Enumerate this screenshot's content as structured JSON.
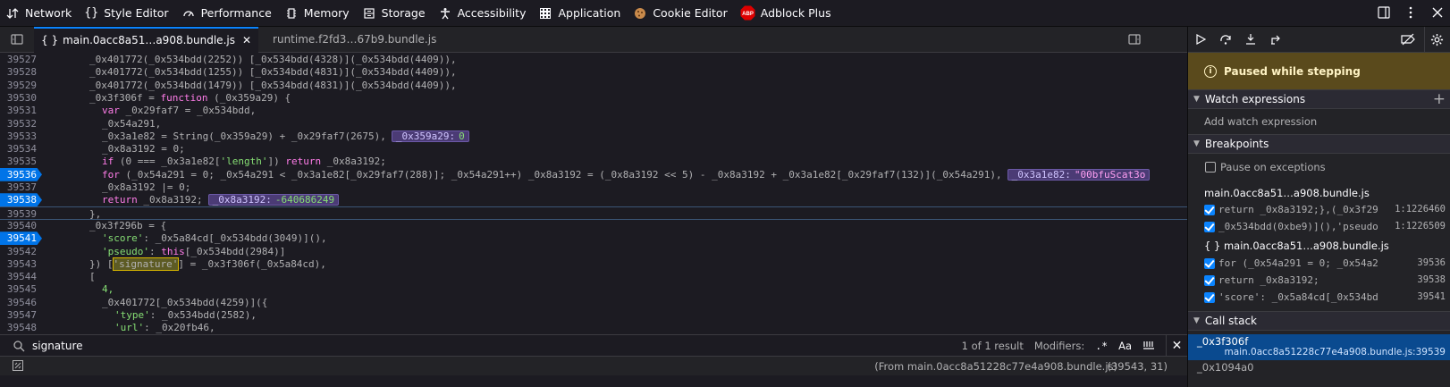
{
  "toolbar": {
    "tabs": [
      {
        "label": "Network",
        "icon": "network-arrows-icon"
      },
      {
        "label": "Style Editor",
        "icon": "braces-icon"
      },
      {
        "label": "Performance",
        "icon": "speedometer-icon"
      },
      {
        "label": "Memory",
        "icon": "memory-chip-icon"
      },
      {
        "label": "Storage",
        "icon": "storage-drawer-icon"
      },
      {
        "label": "Accessibility",
        "icon": "accessibility-person-icon"
      },
      {
        "label": "Application",
        "icon": "grid-dots-icon"
      },
      {
        "label": "Cookie Editor",
        "icon": "cookie-icon"
      },
      {
        "label": "Adblock Plus",
        "icon": "abp-logo-icon"
      }
    ],
    "abp_logo_text": "ABP"
  },
  "editor": {
    "tabs": [
      {
        "label": "main.0acc8a51…a908.bundle.js",
        "active": true
      },
      {
        "label": "runtime.f2fd3…67b9.bundle.js",
        "active": false
      }
    ],
    "tab_braces": "{ }",
    "close_glyph": "✕",
    "lines": [
      {
        "n": "39527",
        "bp": false
      },
      {
        "n": "39528",
        "bp": false
      },
      {
        "n": "39529",
        "bp": false
      },
      {
        "n": "39530",
        "bp": false
      },
      {
        "n": "39531",
        "bp": false
      },
      {
        "n": "39532",
        "bp": false
      },
      {
        "n": "39533",
        "bp": false
      },
      {
        "n": "39534",
        "bp": false
      },
      {
        "n": "39535",
        "bp": false
      },
      {
        "n": "39536",
        "bp": true
      },
      {
        "n": "39537",
        "bp": false
      },
      {
        "n": "39538",
        "bp": true
      },
      {
        "n": "39539",
        "bp": false
      },
      {
        "n": "39540",
        "bp": false
      },
      {
        "n": "39541",
        "bp": true
      },
      {
        "n": "39542",
        "bp": false
      },
      {
        "n": "39543",
        "bp": false
      },
      {
        "n": "39544",
        "bp": false
      },
      {
        "n": "39545",
        "bp": false
      },
      {
        "n": "39546",
        "bp": false
      },
      {
        "n": "39547",
        "bp": false
      },
      {
        "n": "39548",
        "bp": false
      }
    ],
    "code": {
      "l1": "_0x401772(_0x534bdd(2252)) [_0x534bdd(4328)](_0x534bdd(4409)),",
      "l2": "_0x401772(_0x534bdd(1255)) [_0x534bdd(4831)](_0x534bdd(4409)),",
      "l3": "_0x401772(_0x534bdd(1479)) [_0x534bdd(4831)](_0x534bdd(4409)),",
      "l4a": "_0x3f306f = ",
      "l4b": "function",
      "l4c": " (_0x359a29) {",
      "l5a": "var",
      "l5b": " _0x29faf7 = _0x534bdd,",
      "l6": "_0x54a291,",
      "l7a": "_0x3a1e82 = String(_0x359a29) + _0x29faf7(2675),",
      "l7_dbg_name": "_0x359a29:",
      "l7_dbg_val": "0",
      "l8": "_0x8a3192 = 0;",
      "l9a": "if",
      "l9b": " (0 === _0x3a1e82[",
      "l9c": "'length'",
      "l9d": "]) ",
      "l9e": "return",
      "l9f": " _0x8a3192;",
      "l10a": "for",
      "l10b": " (_0x54a291 = 0; _0x54a291 < _0x3a1e82[_0x29faf7(288)]; _0x54a291++) _0x8a3192 = (_0x8a3192 << 5) - _0x8a3192 + _0x3a1e82[_0x29faf7(132)](_0x54a291),",
      "l10_dbg_name": "_0x3a1e82:",
      "l10_dbg_val": "\"00bfuScat3o",
      "l11": "_0x8a3192 |= 0;",
      "l12a": "return",
      "l12b": " _0x8a3192;",
      "l12_dbg_name": "_0x8a3192:",
      "l12_dbg_val": "-640686249",
      "l13": "},",
      "l14": "_0x3f296b = {",
      "l15a": "'score'",
      "l15b": ": _0x5a84cd[_0x534bdd(3049)](),",
      "l16a": "'pseudo'",
      "l16b": ": ",
      "l16c": "this",
      "l16d": "[_0x534bdd(2984)]",
      "l17a": "}) [",
      "l17b": "'signature'",
      "l17c": "] = _0x3f306f(_0x5a84cd),",
      "l18": "[",
      "l19": "4,",
      "l20": "_0x401772[_0x534bdd(4259)]({",
      "l21a": "'type'",
      "l21b": ": _0x534bdd(2582),",
      "l22a": "'url'",
      "l22b": ": _0x20fb46,"
    }
  },
  "search": {
    "query": "signature",
    "result_count": "1 of 1 result",
    "modifiers_label": "Modifiers:",
    "regex_glyph": ".*",
    "case_glyph": "Aa",
    "close_glyph": "✕"
  },
  "status": {
    "source": "(From main.0acc8a51228c77e4a908.bundle.js)",
    "position": "(39543, 31)"
  },
  "debugger": {
    "paused_message": "Paused while stepping",
    "watch_title": "Watch expressions",
    "add_watch": "Add watch expression",
    "add_glyph": "+",
    "breakpoints_title": "Breakpoints",
    "pause_on_exceptions": "Pause on exceptions",
    "bp_group1": "main.0acc8a51…a908.bundle.js",
    "bp_group1_items": [
      {
        "code": "return _0x8a3192;},(_0x3f29…",
        "line": "1:1226460"
      },
      {
        "code": "_0x534bdd(0xbe9)](),'pseudo…",
        "line": "1:1226509"
      }
    ],
    "bp_group2": "{ } main.0acc8a51…a908.bundle.js",
    "bp_group2_items": [
      {
        "code": "for (_0x54a291 = 0; _0x54a291 <…",
        "line": "39536"
      },
      {
        "code": "return _0x8a3192;",
        "line": "39538"
      },
      {
        "code": "'score': _0x5a84cd[_0x534bdd(30…",
        "line": "39541"
      }
    ],
    "callstack_title": "Call stack",
    "frames": [
      {
        "name": "_0x3f306f",
        "source": "main.0acc8a51228c77e4a908.bundle.js:39539"
      },
      {
        "name": "_0x1094a0",
        "source": ""
      }
    ]
  },
  "colors": {
    "accent": "#0a84ff",
    "breakpoint": "#0074e8",
    "paused_banner": "#5a4a1c",
    "selected_frame": "#0a4a8f"
  }
}
